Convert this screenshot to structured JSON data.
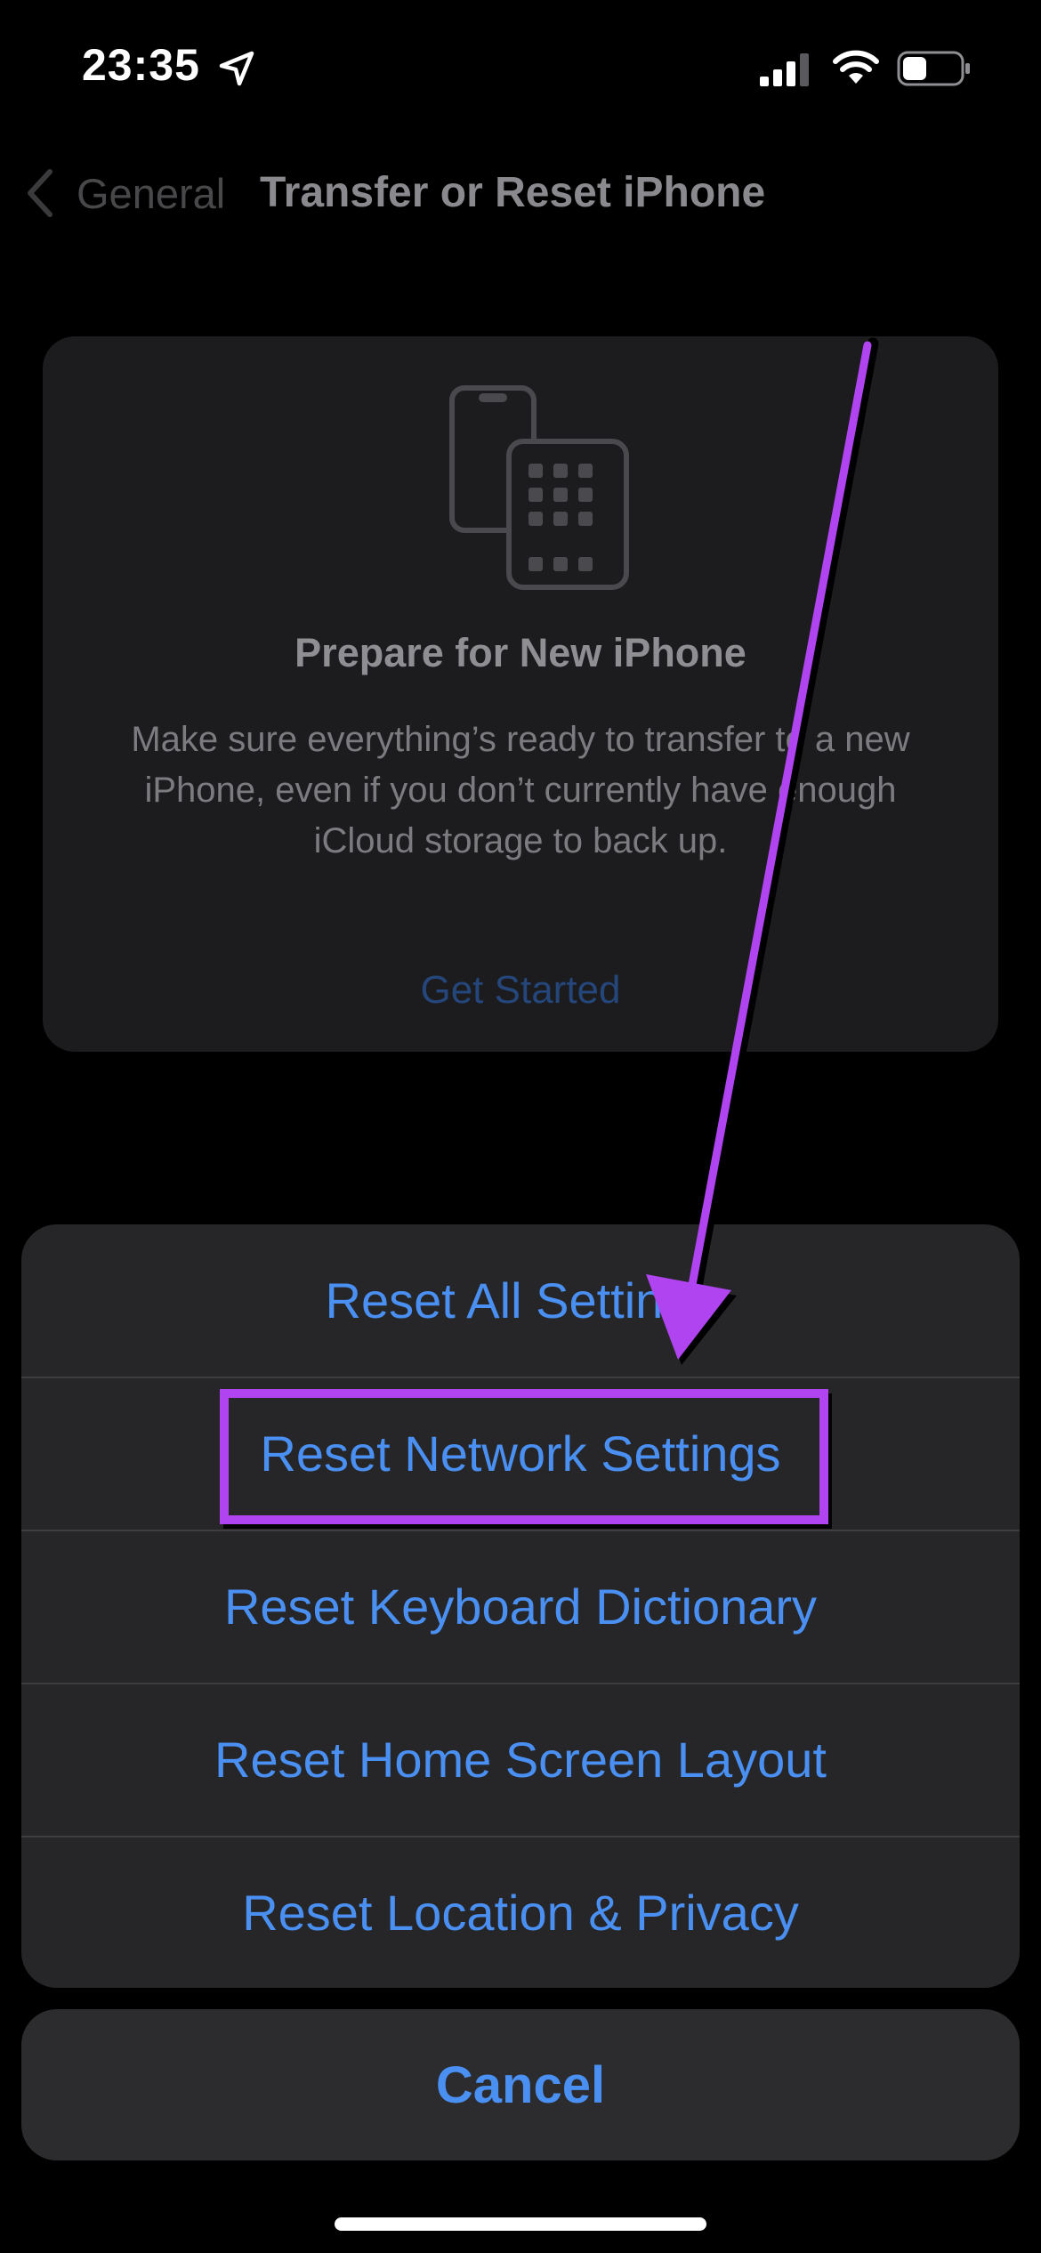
{
  "status_bar": {
    "time": "23:35",
    "icons": [
      "location-arrow-icon",
      "cellular-signal-icon",
      "wifi-icon",
      "battery-icon"
    ]
  },
  "nav": {
    "back_label": "General",
    "title": "Transfer or Reset iPhone"
  },
  "prepare_card": {
    "icon": "phones-transfer-icon",
    "title": "Prepare for New iPhone",
    "description": "Make sure everything’s ready to transfer to a new iPhone, even if you don’t currently have enough iCloud storage to back up.",
    "action_label": "Get Started"
  },
  "action_sheet": {
    "items": [
      {
        "label": "Reset All Settings"
      },
      {
        "label": "Reset Network Settings"
      },
      {
        "label": "Reset Keyboard Dictionary"
      },
      {
        "label": "Reset Home Screen Layout"
      },
      {
        "label": "Reset Location & Privacy"
      }
    ],
    "cancel_label": "Cancel"
  },
  "annotation": {
    "highlighted_item": "Reset Network Settings",
    "color": "#b044f0"
  },
  "colors": {
    "accent_blue": "#4a8ff2",
    "sheet_background": "#262628",
    "annotation_purple": "#b044f0"
  }
}
